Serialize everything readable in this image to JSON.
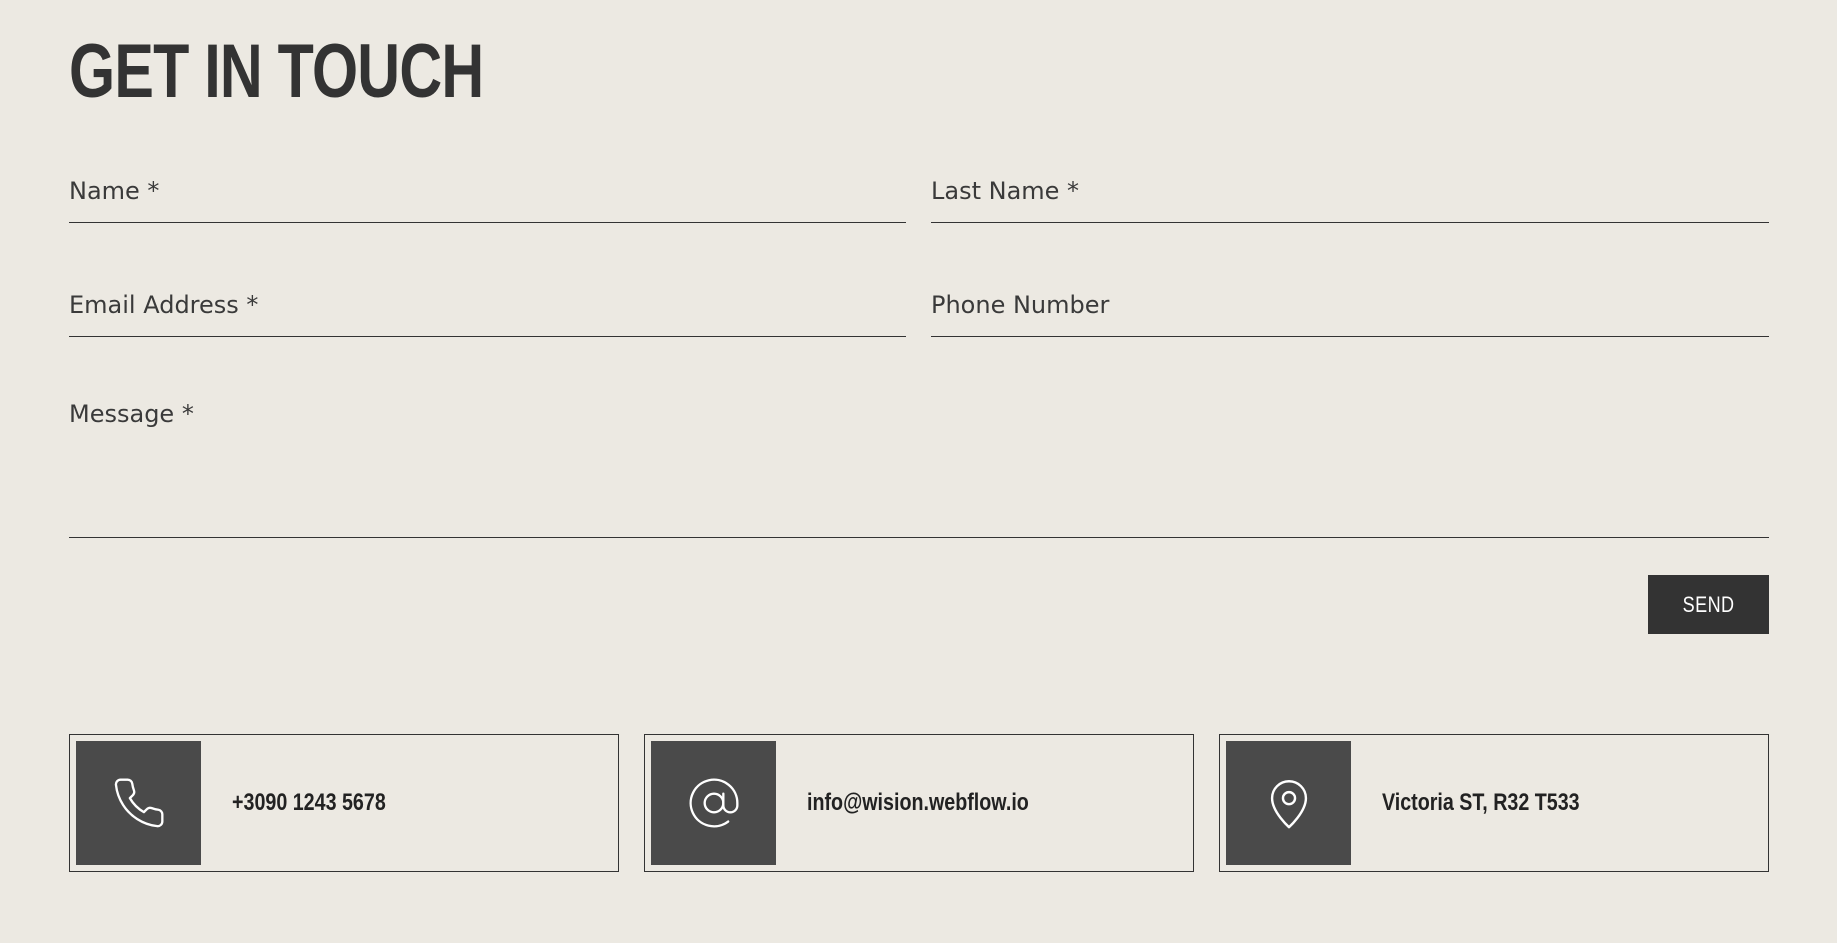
{
  "contact_form": {
    "title": "GET IN TOUCH",
    "fields": {
      "name": {
        "placeholder": "Name *",
        "value": ""
      },
      "last_name": {
        "placeholder": "Last Name *",
        "value": ""
      },
      "email": {
        "placeholder": "Email Address *",
        "value": ""
      },
      "phone": {
        "placeholder": "Phone Number",
        "value": ""
      },
      "message": {
        "placeholder": "Message *",
        "value": ""
      }
    },
    "submit_label": "SEND"
  },
  "contact_info": [
    {
      "icon": "phone-icon",
      "text": "+3090 1243 5678"
    },
    {
      "icon": "at-sign-icon",
      "text": "info@wision.webflow.io"
    },
    {
      "icon": "map-pin-icon",
      "text": "Victoria ST, R32 T533"
    }
  ],
  "colors": {
    "background": "#ece9e2",
    "text": "#333333",
    "button_background": "#333333",
    "button_text": "#ffffff",
    "icon_tile": "#4a4a4a"
  }
}
